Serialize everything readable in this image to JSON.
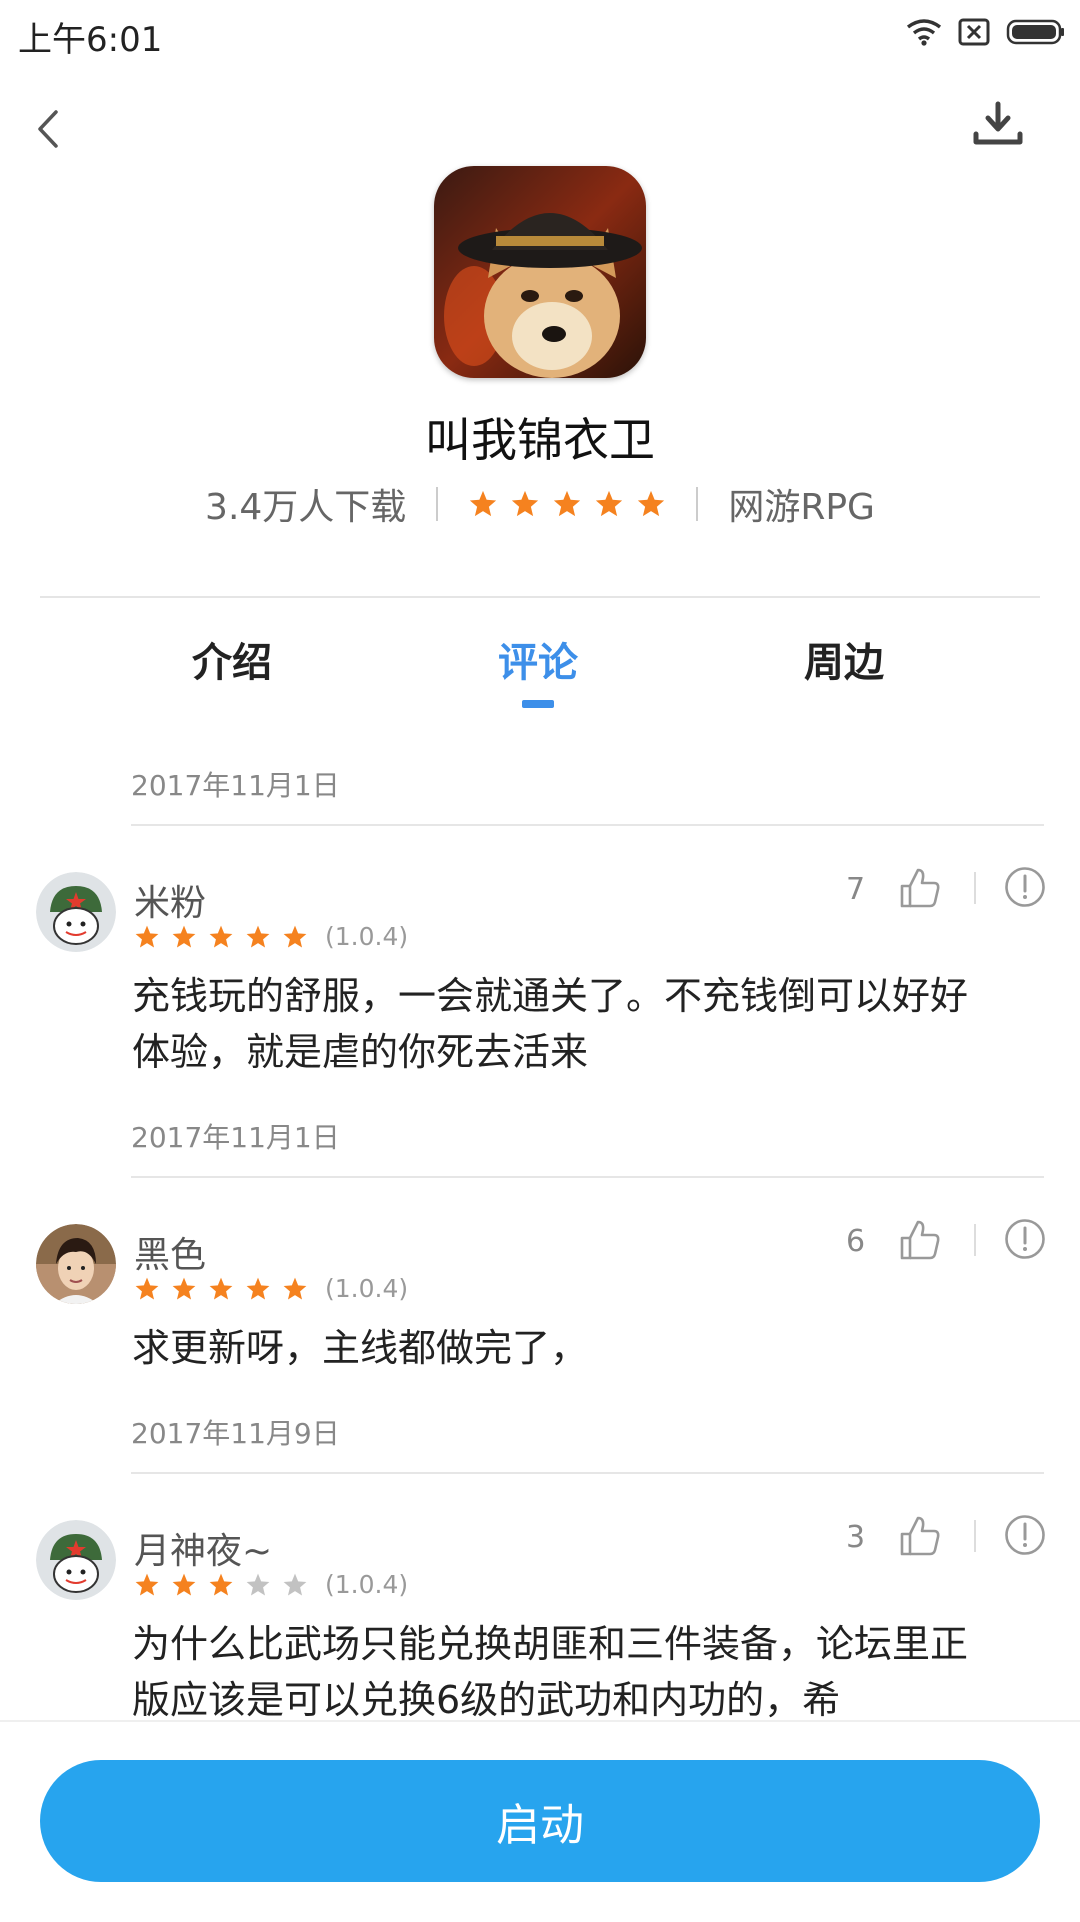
{
  "status_bar": {
    "time": "上午6:01"
  },
  "app": {
    "name": "叫我锦衣卫",
    "downloads": "3.4万人下载",
    "rating": 5,
    "category": "网游RPG"
  },
  "tabs": [
    {
      "label": "介绍",
      "active": false
    },
    {
      "label": "评论",
      "active": true
    },
    {
      "label": "周边",
      "active": false
    }
  ],
  "first_date": "2017年11月1日",
  "reviews": [
    {
      "user": "米粉",
      "likes": "7",
      "stars": 5,
      "version": "(1.0.4)",
      "text": "充钱玩的舒服，一会就通关了。不充钱倒可以好好体验，就是虐的你死去活来",
      "date_after": "2017年11月1日"
    },
    {
      "user": "黑色",
      "likes": "6",
      "stars": 5,
      "version": "(1.0.4)",
      "text": "求更新呀，主线都做完了，",
      "date_after": "2017年11月9日"
    },
    {
      "user": "月神夜~",
      "likes": "3",
      "stars": 3,
      "version": "(1.0.4)",
      "text": "为什么比武场只能兑换胡匪和三件装备，论坛里正版应该是可以兑换6级的武功和内功的，希"
    }
  ],
  "launch_button": "启动",
  "colors": {
    "accent": "#3d8fe9",
    "star": "#f5821f",
    "star_empty": "#c2c2c2",
    "button": "#27a4ee"
  }
}
